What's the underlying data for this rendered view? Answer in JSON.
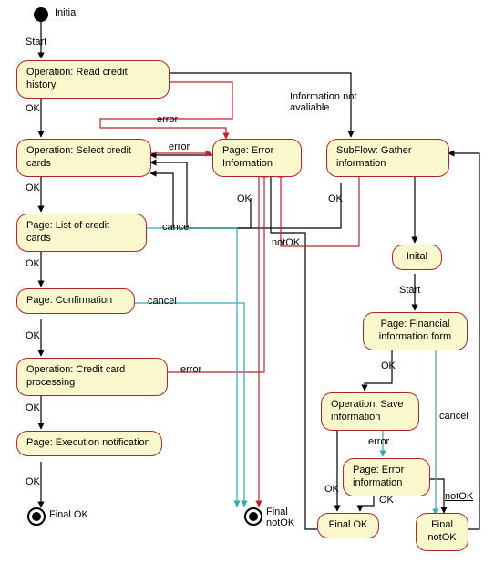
{
  "diagram": {
    "initial_label": "Initial",
    "start_label": "Start",
    "final_ok_label": "Final OK",
    "final_notok_label": "Final\nnotOK",
    "nodes": {
      "read_history": "Operation:\nRead credit history",
      "select_cards": "Operation:\nSelect credit cards",
      "list_cards": "Page:\nList of credit cards",
      "confirmation": "Page:\nConfirmation",
      "processing": "Operation:\nCredit card processing",
      "exec_notif": "Page:\nExecution notification",
      "error_info": "Page:\nError Information",
      "gather": "SubFlow:\nGather information",
      "sub_initial": "Inital",
      "sub_fin_form": "Page: Financial\ninformation form",
      "sub_save": "Operation:\nSave information",
      "sub_error": "Page:\nError information",
      "sub_final_ok": "Final OK",
      "sub_final_notok": "Final\nnotOK"
    },
    "edges": {
      "ok": "OK",
      "error": "error",
      "cancel": "cancel",
      "notok": "notOK",
      "info_na": "Information\nnot avaliable",
      "start": "Start"
    }
  },
  "chart_data": {
    "type": "flowchart",
    "nodes": [
      {
        "id": "initial",
        "kind": "initial",
        "label": "Initial"
      },
      {
        "id": "read_history",
        "kind": "operation",
        "label": "Operation: Read credit history"
      },
      {
        "id": "select_cards",
        "kind": "operation",
        "label": "Operation: Select credit cards"
      },
      {
        "id": "list_cards",
        "kind": "page",
        "label": "Page: List of credit cards"
      },
      {
        "id": "confirmation",
        "kind": "page",
        "label": "Page: Confirmation"
      },
      {
        "id": "processing",
        "kind": "operation",
        "label": "Operation: Credit card processing"
      },
      {
        "id": "exec_notif",
        "kind": "page",
        "label": "Page: Execution notification"
      },
      {
        "id": "final_ok",
        "kind": "final",
        "label": "Final OK"
      },
      {
        "id": "final_notok",
        "kind": "final",
        "label": "Final notOK"
      },
      {
        "id": "error_info",
        "kind": "page",
        "label": "Page: Error Information"
      },
      {
        "id": "gather",
        "kind": "subflow",
        "label": "SubFlow: Gather information"
      },
      {
        "id": "sub_initial",
        "kind": "initial",
        "label": "Inital"
      },
      {
        "id": "sub_fin_form",
        "kind": "page",
        "label": "Page: Financial information form"
      },
      {
        "id": "sub_save",
        "kind": "operation",
        "label": "Operation: Save information"
      },
      {
        "id": "sub_error",
        "kind": "page",
        "label": "Page: Error information"
      },
      {
        "id": "sub_final_ok",
        "kind": "final",
        "label": "Final OK"
      },
      {
        "id": "sub_final_notok",
        "kind": "final",
        "label": "Final notOK"
      }
    ],
    "edges": [
      {
        "from": "initial",
        "to": "read_history",
        "label": "Start"
      },
      {
        "from": "read_history",
        "to": "select_cards",
        "label": "OK"
      },
      {
        "from": "read_history",
        "to": "error_info",
        "label": "error",
        "color": "red"
      },
      {
        "from": "read_history",
        "to": "gather",
        "label": "Information not avaliable"
      },
      {
        "from": "select_cards",
        "to": "list_cards",
        "label": "OK"
      },
      {
        "from": "select_cards",
        "to": "error_info",
        "label": "error",
        "color": "red"
      },
      {
        "from": "list_cards",
        "to": "confirmation",
        "label": "OK"
      },
      {
        "from": "list_cards",
        "to": "final_notok",
        "label": "cancel",
        "color": "teal"
      },
      {
        "from": "confirmation",
        "to": "processing",
        "label": "OK"
      },
      {
        "from": "confirmation",
        "to": "final_notok",
        "label": "cancel",
        "color": "teal"
      },
      {
        "from": "processing",
        "to": "exec_notif",
        "label": "OK"
      },
      {
        "from": "processing",
        "to": "error_info",
        "label": "error",
        "color": "red"
      },
      {
        "from": "exec_notif",
        "to": "final_ok",
        "label": "OK"
      },
      {
        "from": "error_info",
        "to": "select_cards",
        "label": "OK"
      },
      {
        "from": "error_info",
        "to": "final_notok",
        "label": "notOK",
        "color": "red"
      },
      {
        "from": "gather",
        "to": "select_cards",
        "label": "OK"
      },
      {
        "from": "gather",
        "to": "error_info",
        "label": "notOK",
        "color": "red"
      },
      {
        "from": "gather",
        "to": "sub_initial",
        "label": ""
      },
      {
        "from": "sub_initial",
        "to": "sub_fin_form",
        "label": "Start"
      },
      {
        "from": "sub_fin_form",
        "to": "sub_save",
        "label": "OK"
      },
      {
        "from": "sub_fin_form",
        "to": "sub_final_notok",
        "label": "cancel",
        "color": "teal"
      },
      {
        "from": "sub_save",
        "to": "sub_final_ok",
        "label": "OK"
      },
      {
        "from": "sub_save",
        "to": "sub_error",
        "label": "error",
        "color": "teal"
      },
      {
        "from": "sub_error",
        "to": "sub_final_ok",
        "label": "OK"
      },
      {
        "from": "sub_error",
        "to": "sub_final_notok",
        "label": "notOK"
      },
      {
        "from": "sub_final_ok",
        "to": "select_cards",
        "label": ""
      },
      {
        "from": "sub_final_notok",
        "to": "gather",
        "label": ""
      }
    ]
  }
}
